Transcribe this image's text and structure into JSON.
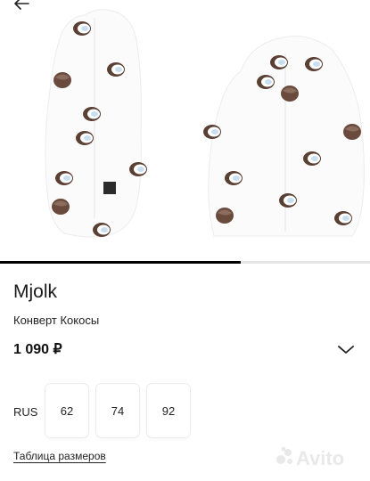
{
  "product": {
    "brand": "Mjolk",
    "title": "Конверт Кокосы",
    "price": "1 090 ₽",
    "image_progress": 0.65
  },
  "sizes": {
    "region": "RUS",
    "options": [
      "62",
      "74",
      "92"
    ]
  },
  "size_chart_link": "Таблица размеров",
  "watermark": {
    "brand": "Avito"
  },
  "icons": {
    "back": "arrow-left-icon",
    "expand": "chevron-down-icon",
    "watermark": "avito-logo-icon"
  },
  "colors": {
    "text": "#111111",
    "progress": "#000000",
    "progress_track": "#e6e6e6",
    "coconut_shell": "#5a3f33",
    "coconut_flesh": "#ffffff",
    "coconut_center": "#c9dff0"
  }
}
